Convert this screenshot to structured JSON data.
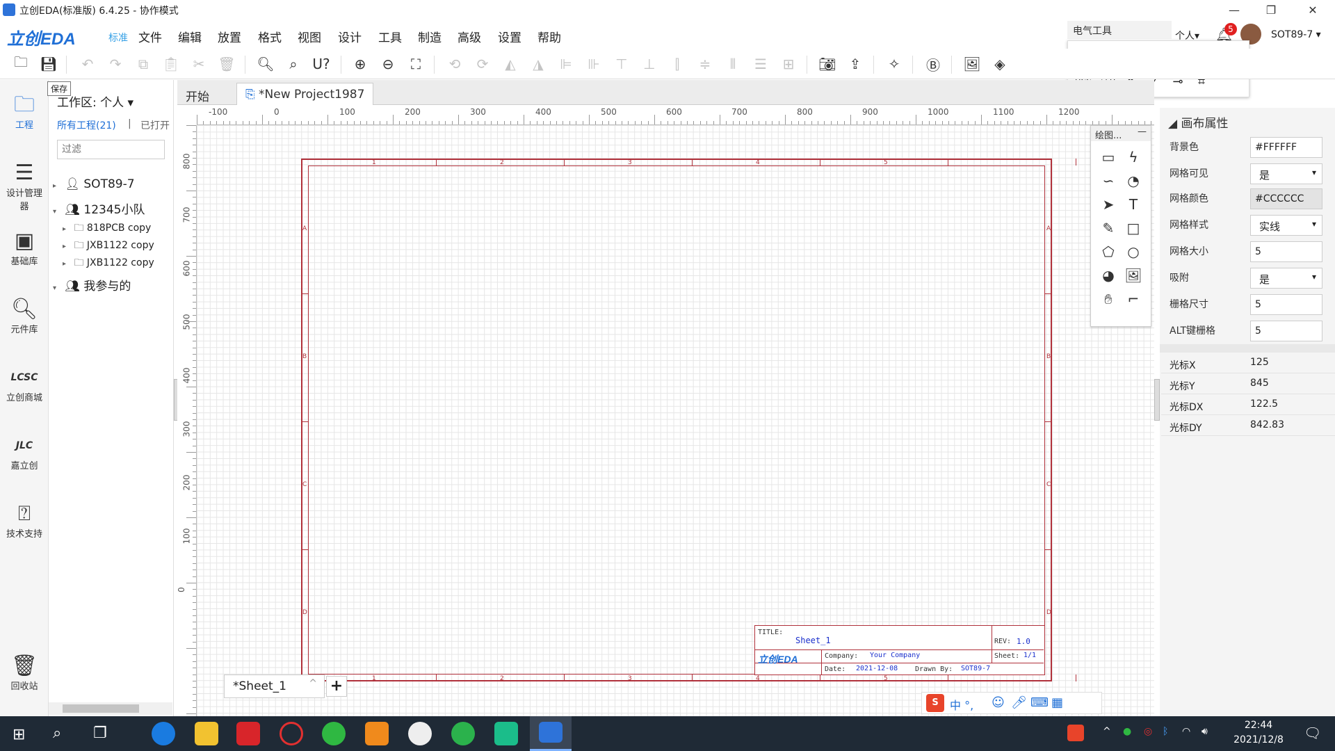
{
  "window": {
    "title": "立创EDA(标准版) 6.4.25 - 协作模式"
  },
  "app": {
    "logo": "立创EDA",
    "edition": "标准"
  },
  "menu": [
    "文件",
    "编辑",
    "放置",
    "格式",
    "视图",
    "设计",
    "工具",
    "制造",
    "高级",
    "设置",
    "帮助"
  ],
  "header_right": {
    "elec_tools_title": "电气工具",
    "personal": "个人▾",
    "notif_count": "5",
    "user": "SOT89-7 ▾"
  },
  "tooltip": "保存",
  "leftnav": [
    "工程",
    "设计管理器",
    "基础库",
    "元件库",
    "立创商城",
    "嘉立创",
    "技术支持",
    "回收站"
  ],
  "projects": {
    "workspace": "工作区: 个人",
    "tab_all": "所有工程(21)",
    "tab_sep": "|",
    "tab_open": "已打开",
    "filter_placeholder": "过滤",
    "tree": [
      {
        "label": "SOT89-7"
      },
      {
        "label": "12345小队"
      },
      {
        "label": "818PCB copy"
      },
      {
        "label": "JXB1122 copy"
      },
      {
        "label": "JXB1122 copy"
      },
      {
        "label": "我参与的"
      }
    ]
  },
  "tabs": [
    "开始",
    "*New Project1987"
  ],
  "ruler": {
    "h": [
      "-100",
      "0",
      "100",
      "200",
      "300",
      "400",
      "500",
      "600",
      "700",
      "800",
      "900",
      "1000",
      "1100",
      "1200"
    ],
    "v": [
      "800",
      "700",
      "600",
      "500",
      "400",
      "300",
      "200",
      "100",
      "0"
    ]
  },
  "sheet": {
    "col_zones": [
      "1",
      "2",
      "3",
      "4",
      "5"
    ],
    "row_zones": [
      "A",
      "B",
      "C",
      "D"
    ],
    "title_label": "TITLE:",
    "title": "Sheet_1",
    "rev_label": "REV:",
    "rev": "1.0",
    "company_label": "Company:",
    "company": "Your Company",
    "sheet_label": "Sheet:",
    "sheet": "1/1",
    "date_label": "Date:",
    "date": "2021-12-08",
    "drawn_label": "Drawn By:",
    "drawn": "SOT89-7",
    "logo": "立创EDA"
  },
  "draw_tools_title": "绘图...",
  "properties": {
    "title": "画布属性",
    "rows": [
      {
        "label": "背景色",
        "value": "#FFFFFF"
      },
      {
        "label": "网格可见",
        "value": "是"
      },
      {
        "label": "网格颜色",
        "value": "#CCCCCC"
      },
      {
        "label": "网格样式",
        "value": "实线"
      },
      {
        "label": "网格大小",
        "value": "5"
      },
      {
        "label": "吸附",
        "value": "是"
      },
      {
        "label": "栅格尺寸",
        "value": "5"
      },
      {
        "label": "ALT键栅格",
        "value": "5"
      }
    ],
    "cursor": [
      {
        "label": "光标X",
        "value": "125"
      },
      {
        "label": "光标Y",
        "value": "845"
      },
      {
        "label": "光标DX",
        "value": "122.5"
      },
      {
        "label": "光标DY",
        "value": "842.83"
      }
    ]
  },
  "sheet_tab": "*Sheet_1",
  "ime": "中 °,",
  "clock": {
    "time": "22:44",
    "date": "2021/12/8"
  },
  "colors": {
    "accent": "#1f6fd6",
    "frame": "#b0303a",
    "taskbar": "#1f2a36"
  }
}
